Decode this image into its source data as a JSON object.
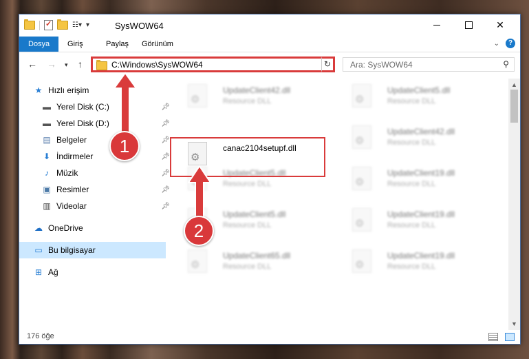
{
  "window": {
    "title": "SysWOW64"
  },
  "quick_access_toolbar": {
    "customize_glyph": "▾"
  },
  "ribbon": {
    "tabs": [
      {
        "label": "Dosya"
      },
      {
        "label": "Giriş"
      },
      {
        "label": "Paylaş"
      },
      {
        "label": "Görünüm"
      }
    ],
    "help_label": "?"
  },
  "address_bar": {
    "path": "C:\\Windows\\SysWOW64"
  },
  "search": {
    "placeholder": "Ara: SysWOW64"
  },
  "sidebar": {
    "items": [
      {
        "label": "Hızlı erişim",
        "icon": "star-icon",
        "pinned": false
      },
      {
        "label": "Yerel Disk (C:)",
        "icon": "drive-icon",
        "pinned": true
      },
      {
        "label": "Yerel Disk (D:)",
        "icon": "drive-icon",
        "pinned": true
      },
      {
        "label": "Belgeler",
        "icon": "documents-icon",
        "pinned": true
      },
      {
        "label": "İndirmeler",
        "icon": "download-icon",
        "pinned": true
      },
      {
        "label": "Müzik",
        "icon": "music-icon",
        "pinned": true
      },
      {
        "label": "Resimler",
        "icon": "pictures-icon",
        "pinned": true
      },
      {
        "label": "Videolar",
        "icon": "video-icon",
        "pinned": true
      },
      {
        "label": "OneDrive",
        "icon": "cloud-icon",
        "pinned": false
      },
      {
        "label": "Bu bilgisayar",
        "icon": "computer-icon",
        "pinned": false,
        "selected": true
      },
      {
        "label": "Ağ",
        "icon": "network-icon",
        "pinned": false
      }
    ]
  },
  "files": [
    {
      "name": "UpdateClient42.dll",
      "type": "Resource DLL",
      "blurred": true
    },
    {
      "name": "UpdateClient5.dll",
      "type": "Resource DLL",
      "blurred": true
    },
    {
      "name": "canac2104setupf.dll",
      "type": "",
      "blurred": false,
      "highlighted": true
    },
    {
      "name": "UpdateClient42.dll",
      "type": "Resource DLL",
      "blurred": true
    },
    {
      "name": "UpdateClient5.dll",
      "type": "Resource DLL",
      "blurred": true
    },
    {
      "name": "UpdateClient19.dll",
      "type": "Resource DLL",
      "blurred": true
    },
    {
      "name": "UpdateClient5.dll",
      "type": "Resource DLL",
      "blurred": true
    },
    {
      "name": "UpdateClient19.dll",
      "type": "Resource DLL",
      "blurred": true
    },
    {
      "name": "UpdateClient65.dll",
      "type": "Resource DLL",
      "blurred": true
    },
    {
      "name": "UpdateClient19.dll",
      "type": "Resource DLL",
      "blurred": true
    }
  ],
  "status_bar": {
    "item_count": "176 öğe"
  },
  "annotations": [
    {
      "label": "1"
    },
    {
      "label": "2"
    }
  ],
  "colors": {
    "accent": "#1979ca",
    "highlight_red": "#d93b3b",
    "selected_bg": "#cce8ff"
  }
}
